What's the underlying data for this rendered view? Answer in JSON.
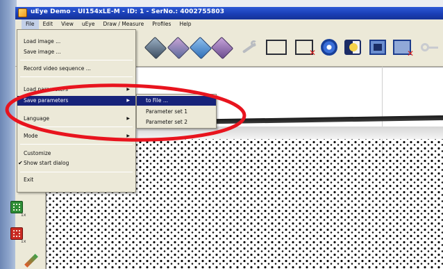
{
  "window": {
    "title": "uEye Demo - UI154xLE-M - ID: 1 - SerNo.: 4002755803"
  },
  "menubar": {
    "items": [
      {
        "label": "File",
        "open": true
      },
      {
        "label": "Edit"
      },
      {
        "label": "View"
      },
      {
        "label": "uEye"
      },
      {
        "label": "Draw / Measure"
      },
      {
        "label": "Profiles"
      },
      {
        "label": "Help"
      }
    ]
  },
  "file_menu": {
    "items": [
      {
        "label": "Load image ..."
      },
      {
        "label": "Save image ..."
      },
      {
        "label": "Record video sequence ..."
      },
      {
        "label": "Load parameters",
        "submenu": true
      },
      {
        "label": "Save parameters",
        "submenu": true,
        "highlighted": true
      },
      {
        "label": "Language",
        "submenu": true
      },
      {
        "label": "Mode",
        "submenu": true
      },
      {
        "label": "Customize"
      },
      {
        "label": "Show start dialog",
        "checked": true
      },
      {
        "label": "Exit"
      }
    ]
  },
  "save_parameters_submenu": {
    "items": [
      {
        "label": "to File ...",
        "highlighted": true
      },
      {
        "label": "Parameter set 1"
      },
      {
        "label": "Parameter set 2"
      }
    ]
  },
  "toolbar": {
    "icons": [
      "camera-cube-icon",
      "camera-cube-purple-icon",
      "camera-cube-blue-icon",
      "camera-cube-violet-icon",
      "wrench-icon",
      "rectangle-icon",
      "rectangle-delete-icon",
      "gear-icon",
      "half-frame-icon",
      "frame-icon",
      "frame-delete-icon",
      "key-icon"
    ]
  },
  "side_tools": {
    "sub_label_1": "1x",
    "sub_label_2": "1x"
  },
  "colors": {
    "highlight": "#17237a",
    "annotation": "#e8141e",
    "titlebar": "#1a3fb6"
  }
}
